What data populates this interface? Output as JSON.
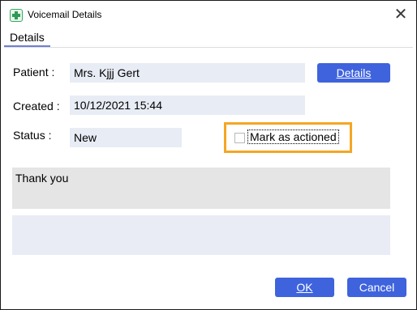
{
  "window": {
    "title": "Voicemail Details"
  },
  "tabs": [
    {
      "label": "Details"
    }
  ],
  "fields": {
    "patient_label": "Patient :",
    "patient_value": "Mrs. Kjjj Gert",
    "created_label": "Created :",
    "created_value": "10/12/2021 15:44",
    "status_label": "Status :",
    "status_value": "New"
  },
  "details_button": {
    "label": "Details"
  },
  "mark_actioned": {
    "label": "Mark as actioned",
    "checked": false
  },
  "notes": {
    "text": "Thank you"
  },
  "ok_button": {
    "label": "OK"
  },
  "cancel_button": {
    "label": "Cancel"
  },
  "colors": {
    "accent": "#3e63dd",
    "highlight": "#f5a623",
    "field_bg": "#e8ecf5"
  },
  "icons": {
    "app": "voicemail-app-icon",
    "close": "close-icon"
  }
}
